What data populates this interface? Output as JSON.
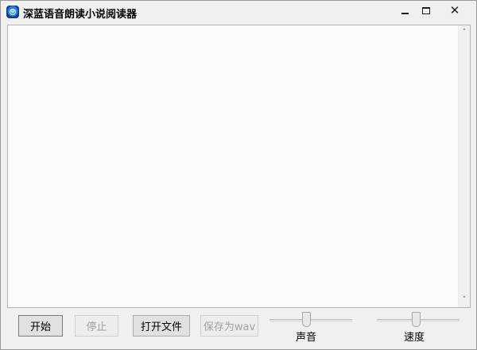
{
  "window": {
    "title": "深蓝语音朗读小说阅读器",
    "icon": "app-speaker-icon",
    "controls": {
      "minimize": "minimize-icon",
      "maximize": "maximize-icon",
      "close": "close-icon",
      "close_glyph": "✕"
    }
  },
  "text_area": {
    "value": "",
    "scroll_up_glyph": "˄",
    "scroll_down_glyph": "˅"
  },
  "buttons": {
    "start": "开始",
    "stop": "停止",
    "open_file": "打开文件",
    "save_wav": "保存为wav"
  },
  "sliders": {
    "volume": {
      "label": "声音"
    },
    "speed": {
      "label": "速度"
    }
  }
}
